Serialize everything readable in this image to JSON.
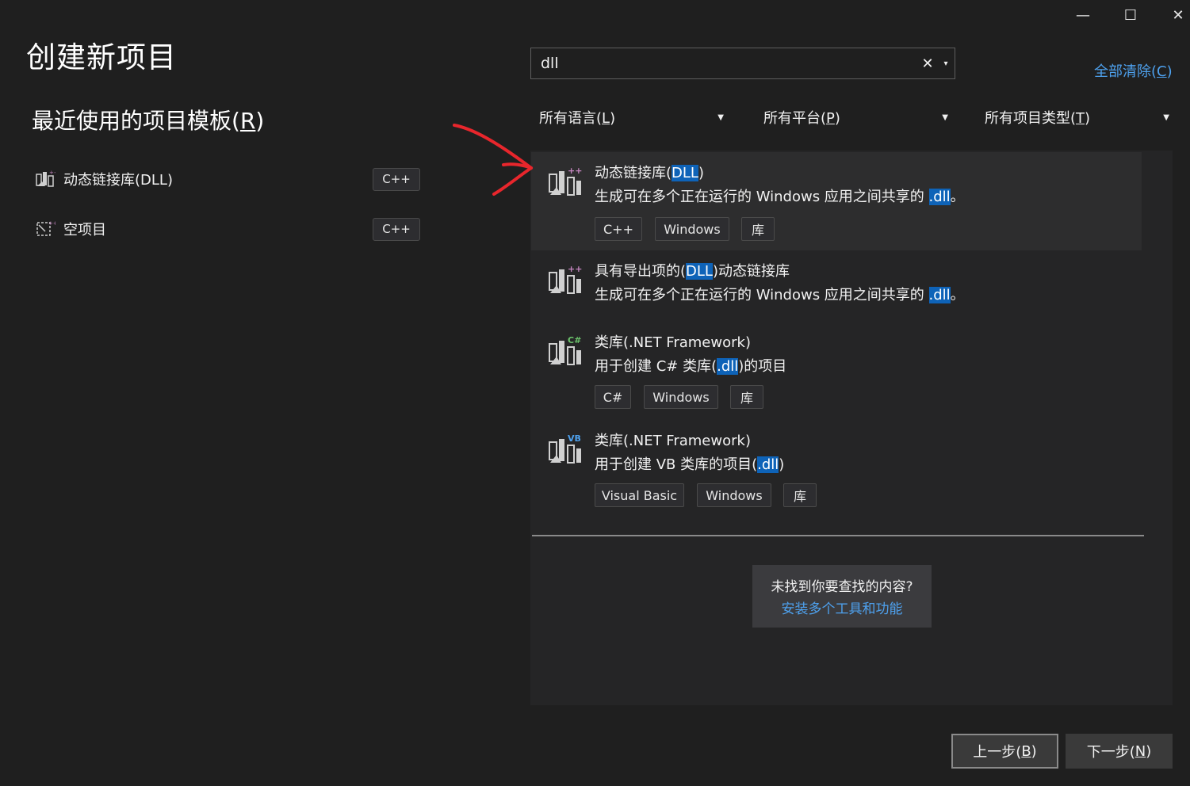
{
  "window_controls": {
    "minimize": "—",
    "maximize": "☐",
    "close": "✕"
  },
  "page_title": "创建新项目",
  "recent": {
    "title_prefix": "最近使用的项目模板(",
    "title_key": "R",
    "title_suffix": ")",
    "items": [
      {
        "label": "动态链接库(DLL)",
        "lang": "C++",
        "icon": "dll-template-icon"
      },
      {
        "label": "空项目",
        "lang": "C++",
        "icon": "empty-project-icon"
      }
    ]
  },
  "search": {
    "value": "dll",
    "clear": "✕",
    "dropdown": "▾"
  },
  "clear_all": {
    "prefix": "全部清除(",
    "key": "C",
    "suffix": ")"
  },
  "filters": [
    {
      "prefix": "所有语言(",
      "key": "L",
      "suffix": ")"
    },
    {
      "prefix": "所有平台(",
      "key": "P",
      "suffix": ")"
    },
    {
      "prefix": "所有项目类型(",
      "key": "T",
      "suffix": ")"
    }
  ],
  "results": [
    {
      "name_pre": "动态链接库(",
      "name_hl": "DLL",
      "name_post": ")",
      "desc_pre": "生成可在多个正在运行的 Windows 应用之间共享的 ",
      "desc_hl": ".dll",
      "desc_post": "。",
      "badge": "++",
      "badge_color": "#c586c0",
      "tags": [
        "C++",
        "Windows",
        "库"
      ]
    },
    {
      "name_pre": "具有导出项的(",
      "name_hl": "DLL",
      "name_post": ")动态链接库",
      "desc_pre": "生成可在多个正在运行的 Windows 应用之间共享的 ",
      "desc_hl": ".dll",
      "desc_post": "。",
      "badge": "++",
      "badge_color": "#c586c0",
      "tags": []
    },
    {
      "name_pre": "类库(.NET Framework)",
      "name_hl": "",
      "name_post": "",
      "desc_pre": "用于创建 C# 类库(",
      "desc_hl": ".dll",
      "desc_post": ")的项目",
      "badge": "C#",
      "badge_color": "#6cc46c",
      "tags": [
        "C#",
        "Windows",
        "库"
      ]
    },
    {
      "name_pre": "类库(.NET Framework)",
      "name_hl": "",
      "name_post": "",
      "desc_pre": "用于创建 VB 类库的项目(",
      "desc_hl": ".dll",
      "desc_post": ")",
      "badge": "VB",
      "badge_color": "#4ea1ee",
      "tags": [
        "Visual Basic",
        "Windows",
        "库"
      ]
    }
  ],
  "not_found": {
    "question": "未找到你要查找的内容?",
    "link": "安装多个工具和功能"
  },
  "buttons": {
    "back": {
      "prefix": "上一步(",
      "key": "B",
      "suffix": ")"
    },
    "next": {
      "prefix": "下一步(",
      "key": "N",
      "suffix": ")"
    }
  },
  "colors": {
    "accent": "#4ea1ee",
    "highlight": "#0e63b8",
    "annotation": "#e8262c"
  }
}
